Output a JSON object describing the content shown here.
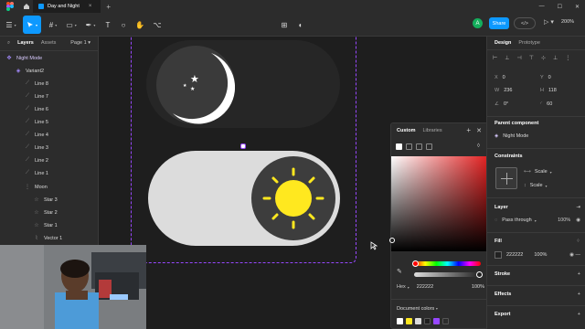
{
  "app": {
    "tab_title": "Day and Night",
    "tab_close": "×",
    "new_tab": "+"
  },
  "toolbar": {
    "avatar": "A",
    "share_label": "Share",
    "dev_label": "</>",
    "zoom": "200%"
  },
  "left_panel": {
    "tabs": [
      "Layers",
      "Assets"
    ],
    "page": "Page 1",
    "layers": [
      {
        "name": "Night Mode",
        "icon": "frame-icon"
      },
      {
        "name": "Variant2",
        "icon": "component-icon"
      },
      {
        "name": "Line 8",
        "icon": "line-icon"
      },
      {
        "name": "Line 7",
        "icon": "line-icon"
      },
      {
        "name": "Line 6",
        "icon": "line-icon"
      },
      {
        "name": "Line 5",
        "icon": "line-icon"
      },
      {
        "name": "Line 4",
        "icon": "line-icon"
      },
      {
        "name": "Line 3",
        "icon": "line-icon"
      },
      {
        "name": "Line 2",
        "icon": "line-icon"
      },
      {
        "name": "Line 1",
        "icon": "line-icon"
      },
      {
        "name": "Moon",
        "icon": "group-icon"
      },
      {
        "name": "Star 3",
        "icon": "star-icon"
      },
      {
        "name": "Star 2",
        "icon": "star-icon"
      },
      {
        "name": "Star 1",
        "icon": "star-icon"
      },
      {
        "name": "Vector 1",
        "icon": "vector-icon"
      }
    ]
  },
  "color_picker": {
    "tabs": [
      "Custom",
      "Libraries"
    ],
    "format": "Hex",
    "hex": "222222",
    "opacity": "100%",
    "doc_colors_label": "Document colors",
    "swatches": [
      "#ffffff",
      "#ffe81f",
      "#dcdcdc",
      "#1e1e1e",
      "#9747ff",
      "#2c2c2c"
    ]
  },
  "right_panel": {
    "tabs": [
      "Design",
      "Prototype"
    ],
    "x": "0",
    "y": "0",
    "w": "236",
    "h": "118",
    "rotation": "0°",
    "radius": "60",
    "labels": {
      "x": "X",
      "y": "Y",
      "w": "W",
      "h": "H"
    },
    "parent_component_title": "Parent component",
    "parent_component": "Night Mode",
    "constraints_title": "Constraints",
    "constraint_h": "Scale",
    "constraint_v": "Scale",
    "layer_title": "Layer",
    "blend": "Pass through",
    "layer_opacity": "100%",
    "fill_title": "Fill",
    "fill_hex": "222222",
    "fill_opacity": "100%",
    "stroke_title": "Stroke",
    "effects_title": "Effects",
    "export_title": "Export"
  }
}
